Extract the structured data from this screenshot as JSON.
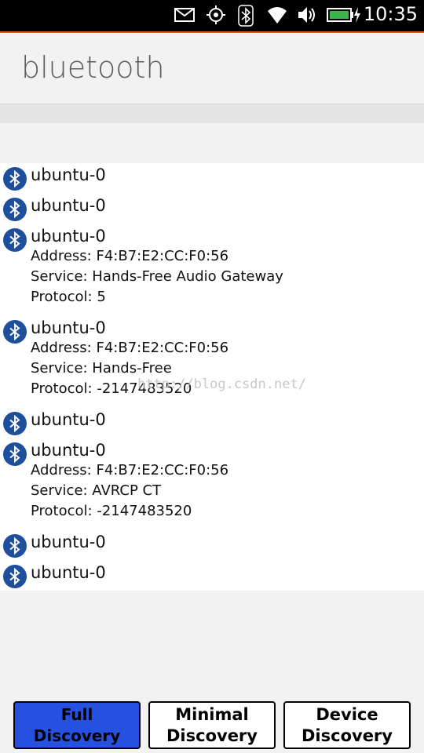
{
  "status_bar": {
    "time": "10:35",
    "icons": [
      "mail-icon",
      "location-icon",
      "bluetooth-icon",
      "wifi-icon",
      "volume-icon",
      "battery-icon"
    ],
    "accent_color": "#e95420"
  },
  "header": {
    "title": "bluetooth"
  },
  "devices": [
    {
      "name": "ubuntu-0"
    },
    {
      "name": "ubuntu-0"
    },
    {
      "name": "ubuntu-0",
      "address": "Address: F4:B7:E2:CC:F0:56",
      "service": "Service: Hands-Free Audio Gateway",
      "protocol": "Protocol: 5"
    },
    {
      "name": "ubuntu-0",
      "address": "Address: F4:B7:E2:CC:F0:56",
      "service": "Service: Hands-Free",
      "protocol": "Protocol: -2147483520"
    },
    {
      "name": "ubuntu-0"
    },
    {
      "name": "ubuntu-0",
      "address": "Address: F4:B7:E2:CC:F0:56",
      "service": "Service: AVRCP CT",
      "protocol": "Protocol: -2147483520"
    },
    {
      "name": "ubuntu-0"
    },
    {
      "name": "ubuntu-0"
    }
  ],
  "buttons": {
    "full": "Full Discovery",
    "minimal_line1": "Minimal",
    "minimal_line2": "Discovery",
    "device_line1": "Device",
    "device_line2": "Discovery"
  },
  "watermark": "http://blog.csdn.net/",
  "colors": {
    "bluetooth_icon": "#1d4f9c",
    "primary_button": "#2550e0"
  }
}
